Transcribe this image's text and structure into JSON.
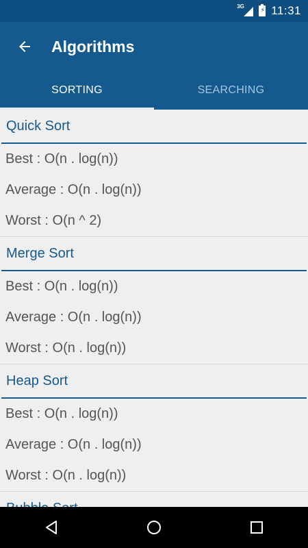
{
  "status": {
    "network": "3G",
    "time": "11:31"
  },
  "appbar": {
    "title": "Algorithms"
  },
  "tabs": [
    {
      "label": "SORTING",
      "active": true
    },
    {
      "label": "SEARCHING",
      "active": false
    }
  ],
  "sections": [
    {
      "name": "Quick Sort",
      "rows": [
        "Best : O(n . log(n))",
        "Average : O(n . log(n))",
        "Worst : O(n ^ 2)"
      ]
    },
    {
      "name": "Merge Sort",
      "rows": [
        "Best : O(n . log(n))",
        "Average : O(n . log(n))",
        "Worst : O(n . log(n))"
      ]
    },
    {
      "name": "Heap Sort",
      "rows": [
        "Best : O(n . log(n))",
        "Average : O(n . log(n))",
        "Worst : O(n . log(n))"
      ]
    },
    {
      "name": "Bubble Sort",
      "rows": []
    }
  ],
  "colors": {
    "primary": "#145a8f",
    "statusbar": "#0f4e80",
    "background": "#efefef"
  }
}
